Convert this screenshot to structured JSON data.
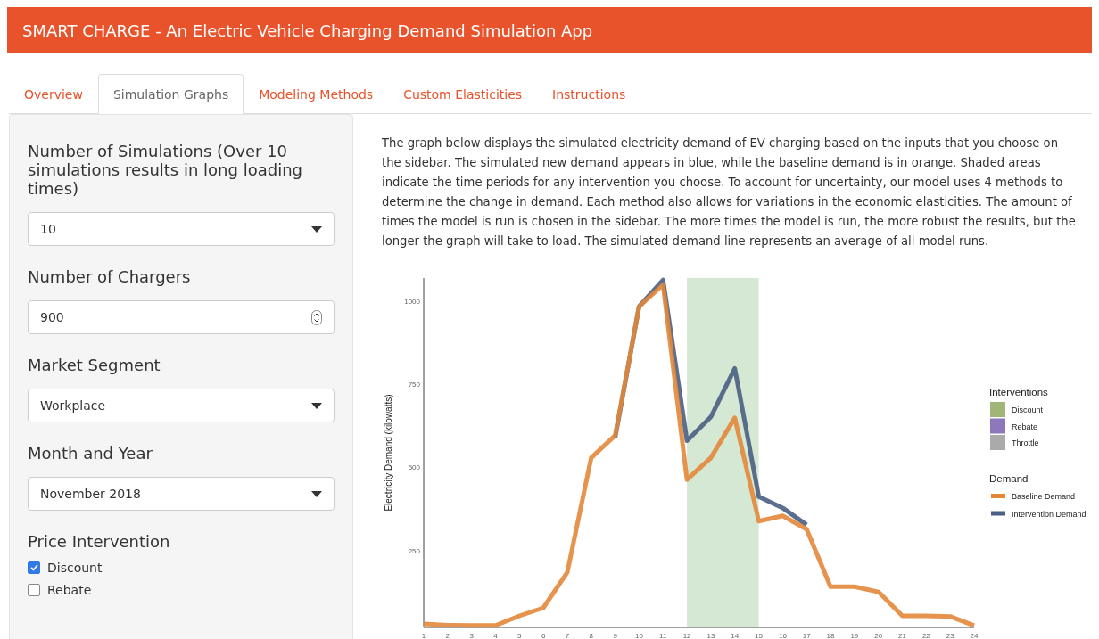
{
  "header": {
    "title": "SMART CHARGE - An Electric Vehicle Charging Demand Simulation App"
  },
  "tabs": [
    {
      "label": "Overview",
      "selected": false
    },
    {
      "label": "Simulation Graphs",
      "selected": true
    },
    {
      "label": "Modeling Methods",
      "selected": false
    },
    {
      "label": "Custom Elasticities",
      "selected": false
    },
    {
      "label": "Instructions",
      "selected": false
    }
  ],
  "sidebar": {
    "fields": [
      {
        "kind": "select",
        "label": "Number of Simulations (Over 10 simulations results in long loading times)",
        "value": "10"
      },
      {
        "kind": "number",
        "label": "Number of Chargers",
        "value": "900"
      },
      {
        "kind": "select",
        "label": "Market Segment",
        "value": "Workplace"
      },
      {
        "kind": "select",
        "label": "Month and Year",
        "value": "November 2018"
      }
    ],
    "price_intervention": {
      "label": "Price Intervention",
      "options": [
        {
          "label": "Discount",
          "checked": true
        },
        {
          "label": "Rebate",
          "checked": false
        }
      ]
    }
  },
  "main": {
    "description": "The graph below displays the simulated electricity demand of EV charging based on the inputs that you choose on the sidebar. The simulated new demand appears in blue, while the baseline demand is in orange. Shaded areas indicate the time periods for any intervention you choose. To account for uncertainty, our model uses 4 methods to determine the change in demand. Each method also allows for variations in the economic elasticities. The amount of times the model is run is chosen in the sidebar. The more times the model is run, the more robust the results, but the longer the graph will take to load. The simulated demand line represents an average of all model runs.",
    "chart": {
      "chart_data": {
        "type": "line",
        "ylabel": "Electricity Demand (kilowatts)",
        "x": [
          1,
          2,
          3,
          4,
          5,
          6,
          7,
          8,
          9,
          10,
          11,
          12,
          13,
          14,
          15,
          16,
          17,
          18,
          19,
          20,
          21,
          22,
          23,
          24
        ],
        "series": [
          {
            "name": "Baseline Demand",
            "color": "#e2873a",
            "values": [
              29,
              25,
              24,
              24,
              53,
              77,
              184,
              529,
              596,
              984,
              1050,
              463,
              529,
              649,
              338,
              354,
              314,
              141,
              141,
              125,
              53,
              53,
              51,
              24
            ]
          },
          {
            "name": "Intervention Demand",
            "color": "#4a5f82",
            "values": [
              null,
              null,
              null,
              null,
              null,
              null,
              null,
              null,
              590,
              984,
              1064,
              580,
              652,
              798,
              412,
              378,
              327,
              null,
              null,
              null,
              null,
              null,
              null,
              null
            ]
          }
        ],
        "xlim": [
          1,
          24
        ],
        "ylim": [
          18,
          1070
        ],
        "xticks": [
          1,
          2,
          3,
          4,
          5,
          6,
          7,
          8,
          9,
          10,
          11,
          12,
          13,
          14,
          15,
          16,
          17,
          18,
          19,
          20,
          21,
          22,
          23,
          24
        ],
        "yticks": [
          250,
          500,
          750,
          1000
        ],
        "bands": [
          {
            "axis": "x",
            "from": 12,
            "to": 15,
            "color": "#d5e8d4"
          }
        ],
        "legend": "right"
      },
      "legend": {
        "interventions_title": "Interventions",
        "interventions": [
          {
            "label": "Discount",
            "color": "#a0b678"
          },
          {
            "label": "Rebate",
            "color": "#8e77ba"
          },
          {
            "label": "Throttle",
            "color": "#aaaaaa"
          }
        ],
        "demand_title": "Demand"
      }
    }
  }
}
